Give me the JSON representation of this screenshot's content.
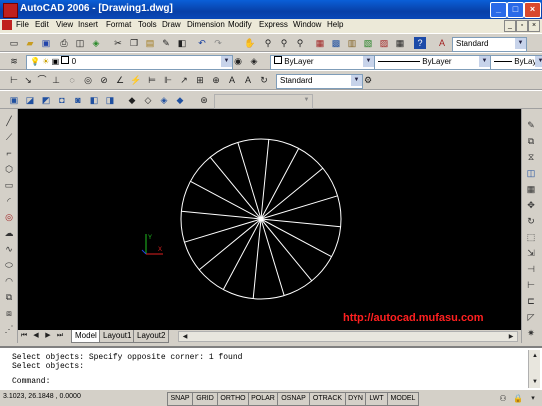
{
  "window": {
    "title": "AutoCAD 2006 - [Drawing1.dwg]",
    "controls": [
      "_",
      "□",
      "×"
    ]
  },
  "menu": {
    "items": [
      "File",
      "Edit",
      "View",
      "Insert",
      "Format",
      "Tools",
      "Draw",
      "Dimension",
      "Modify",
      "Express",
      "Window",
      "Help"
    ]
  },
  "toolbar_standard": {
    "text_style": "Standard"
  },
  "toolbar_layers": {
    "layer": "0",
    "color": "ByLayer",
    "linetype": "ByLayer",
    "lineweight": "ByLayer"
  },
  "toolbar_dim": {
    "dim_style": "Standard"
  },
  "drawing": {
    "circle_segments": 16,
    "watermark": "http://autocad.mufasu.com",
    "ucs_y": "Y",
    "ucs_x": "X"
  },
  "layout_tabs": {
    "model": "Model",
    "layout1": "Layout1",
    "layout2": "Layout2"
  },
  "command": {
    "line1": "Select objects: Specify opposite corner: 1 found",
    "line2": "Select objects:",
    "prompt": "Command:"
  },
  "status": {
    "coords": "3.1023, 26.1848 , 0.0000",
    "buttons": [
      "SNAP",
      "GRID",
      "ORTHO",
      "POLAR",
      "OSNAP",
      "OTRACK",
      "DYN",
      "LWT",
      "MODEL"
    ]
  },
  "colors": {
    "title_bar": "#0a48b8",
    "canvas": "#000000",
    "watermark": "#ff2020",
    "circle": "#ffffff"
  }
}
